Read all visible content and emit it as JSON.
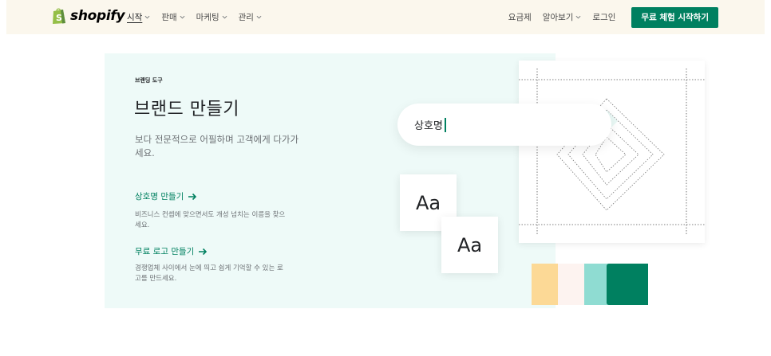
{
  "nav": {
    "logo_text": "shopify",
    "menu": [
      {
        "label": "시작",
        "active": true
      },
      {
        "label": "판매",
        "active": false
      },
      {
        "label": "마케팅",
        "active": false
      },
      {
        "label": "관리",
        "active": false
      }
    ],
    "pricing": "요금제",
    "learn": "알아보기",
    "login": "로그인",
    "cta": "무료 체험 시작하기"
  },
  "hero": {
    "eyebrow": "브랜딩 도구",
    "title": "브랜드 만들기",
    "description": "보다 전문적으로 어필하며 고객에게 다가가세요.",
    "links": [
      {
        "title": "상호명 만들기",
        "description": "비즈니스 컨셉에 맞으면서도 개성 넘치는 이름을 찾으세요."
      },
      {
        "title": "무료 로고 만들기",
        "description": "경쟁업체 사이에서 눈에 띄고 쉽게 기억할 수 있는 로고를 만드세요."
      }
    ]
  },
  "illustration": {
    "search_text": "상호명",
    "font_sample": "Aa",
    "swatches": [
      "#fcd996",
      "#fdf3f0",
      "#8fdcd2",
      "#008060"
    ]
  },
  "colors": {
    "accent": "#008060",
    "nav_bg": "#fbf7ed",
    "panel_bg": "#eefaf8"
  }
}
